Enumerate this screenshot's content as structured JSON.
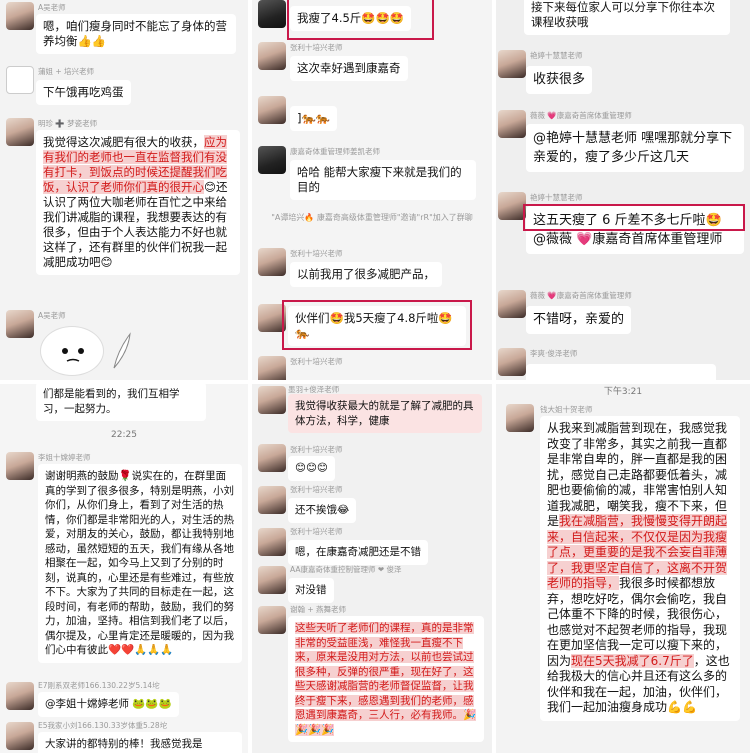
{
  "panel1": {
    "m1": {
      "name": "A吴老师",
      "text": "嗯，咱们瘦身同时不能忘了身体的营养均衡👍👍"
    },
    "m2": {
      "name": "蒲姐 + 培兴老师",
      "text": "下午饿再吃鸡蛋"
    },
    "m3": {
      "name": "明珍 ➕ 梦瓷老师",
      "text_a": "我觉得这次减肥有很大的收获，",
      "text_b": "应为有我们的老师也一直在监督我们有没有打卡，到饭点的时候还提醒我们吃饭，认识了老师你们真的很开心",
      "text_c": "😊还认识了两位大咖老师在百忙之中来给我们讲减脂的课程，我想要表达的有很多，但由于个人表达能力不好也就这样了，还有群里的伙伴们祝我一起减肥成功吧😊"
    },
    "m4": {
      "name": "A吴老师"
    }
  },
  "panel2": {
    "m1": {
      "text": "我瘦了4.5斤🤩🤩🤩"
    },
    "m2": {
      "name": "张利十培兴老师",
      "text": "这次幸好遇到康嘉奇"
    },
    "m3": {
      "text": "]🐅🐅"
    },
    "m4": {
      "name": "康嘉奇体重管理师姜凯老师",
      "text": "哈哈  能帮大家瘦下来就是我们的目的"
    },
    "sys_a": "\"A谭培兴🔥 康嘉奇高级体重管理师\"邀请\"rR\"加入了群聊",
    "m5": {
      "name": "张利十培兴老师",
      "text": "以前我用了很多减肥产品，"
    },
    "m6": {
      "text": "伙伴们🤩我5天瘦了4.8斤啦🤩🐅"
    },
    "m7": {
      "name": "张利十培兴老师"
    }
  },
  "panel3": {
    "m0": {
      "text": "接下来每位家人可以分享下你往本次课程收获哦"
    },
    "m1": {
      "name": "艳婷十慧慧老师",
      "text": "收获很多"
    },
    "m2": {
      "name": "薇薇 💗康嘉奇首席体重管理师",
      "text": "@艳婷十慧慧老师  嘿嘿那就分享下亲爱的，瘦了多少斤这几天"
    },
    "m3": {
      "name": "艳婷十慧慧老师",
      "text_a": "这五天瘦了 6 斤差不多七斤啦🤩",
      "text_b": "@薇薇 💗康嘉奇首席体重管理师"
    },
    "m4": {
      "name": "薇薇 💗康嘉奇首席体重管理师",
      "text": "不错呀，亲爱的"
    },
    "m5": {
      "name": "李爽·俊泽老师"
    }
  },
  "panel4": {
    "top_text": "们都是能看到的，我们互相学习，一起努力。",
    "time": "22:25",
    "m1": {
      "name": "李姐十嫦婷老师",
      "text": "谢谢明燕的鼓励🌹说实在的，在群里面真的学到了很多很多，特别是明燕，小刘你们，从你们身上，看到了对生活的热情，你们都是非常阳光的人，对生活的热爱，对朋友的关心，鼓励，都让我特别地感动，虽然短短的五天，我们有缘从各地相聚在一起，如今马上又到了分别的时刻，说真的，心里还是有些难过，有些放不下。大家为了共同的目标走在一起，这段时间，有老师的帮助，鼓励，我们的努力，加油，坚持。相信到我们老了以后，偶尔提及，心里肯定还是暖暖的，因为我们心中有彼此❤️❤️🙏🙏🙏"
    },
    "m2": {
      "name": "E7刚系双老师166.130.22岁5.14坨",
      "text": "@李姐十嫦婷老师  🐸🐸🐸"
    },
    "m3": {
      "name": "E5我家小刘166.130.33岁体重5.28坨",
      "text": "大家讲的都特别的棒！我感觉我是"
    }
  },
  "panel5": {
    "m1": {
      "name": "墨羽+俊泽老师",
      "text": "我觉得收获最大的就是了解了减肥的具体方法，科学，健康"
    },
    "m2": {
      "name": "张利十培兴老师",
      "text": "😊😊😊"
    },
    "m3": {
      "name": "张利十培兴老师",
      "text": "还不挨饿😂"
    },
    "m4": {
      "name": "张利十培兴老师",
      "text": "嗯，在康嘉奇减肥还是不错"
    },
    "m5": {
      "name": "AA康嘉奇体重控制管理师 ❤ 俊泽",
      "text": "对没错"
    },
    "m6": {
      "name": "谢翰 + 燕舞老师",
      "text": "这些天听了老师们的课程，真的是非常非常的受益匪浅，难怪我一直瘦不下来，原来是没用对方法，以前也尝试过很多种，反弹的很严重，现在好了，这些天感谢减脂营的老师督促监督，让我终于瘦下来，感恩遇到我们的老师，感恩遇到康嘉奇，三人行，必有我师。🎉🎉🎉🎉"
    }
  },
  "panel6": {
    "time": "下午3:21",
    "m1": {
      "name": "钱大姐十贺老师",
      "text_a": "从我来到减脂营到现在，我感觉我改变了非常多，其实之前我一直都是非常自卑的，胖一直都是我的困扰，感觉自己走路都要低着头，减肥也要偷偷的减，非常害怕别人知道我减肥，嘲笑我，瘦不下来，但是",
      "text_b": "我在减脂营，我慢慢变得开朗起来，自信起来，不仅仅是因为我瘦了点，更重要的是我不会妄自菲薄了，我更坚定自信了，这离不开贺老师的指导，",
      "text_c": "我很多时候都想放弃，想吃好吃，偶尔会偷吃，我自己体重不下降的时候，我很伤心，也感觉对不起贺老师的指导，我现在更加坚信我一定可以瘦下来的，因为",
      "text_d": "现在5天我减了6.7斤了",
      "text_e": "，这也给我极大的信心并且还有这么多的伙伴和我在一起，加油，伙伴们，我们一起加油瘦身成功💪💪"
    }
  }
}
